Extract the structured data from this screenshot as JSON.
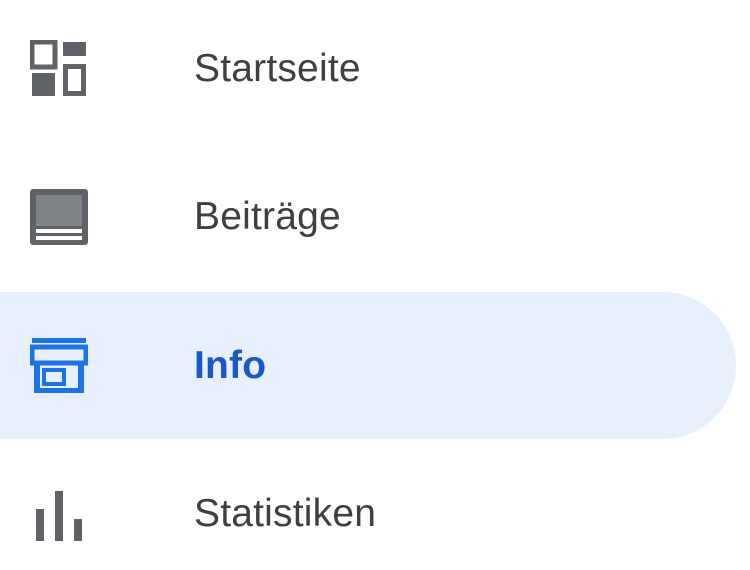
{
  "nav": {
    "items": [
      {
        "label": "Startseite",
        "icon": "dashboard-icon",
        "active": false
      },
      {
        "label": "Beiträge",
        "icon": "posts-icon",
        "active": false
      },
      {
        "label": "Info",
        "icon": "storefront-icon",
        "active": true
      },
      {
        "label": "Statistiken",
        "icon": "bar-chart-icon",
        "active": false
      }
    ]
  },
  "colors": {
    "icon": "#5f6368",
    "text": "#3c4043",
    "active_text": "#1a57c9",
    "active_icon": "#1a73e8",
    "active_bg": "#e8f0fe"
  }
}
